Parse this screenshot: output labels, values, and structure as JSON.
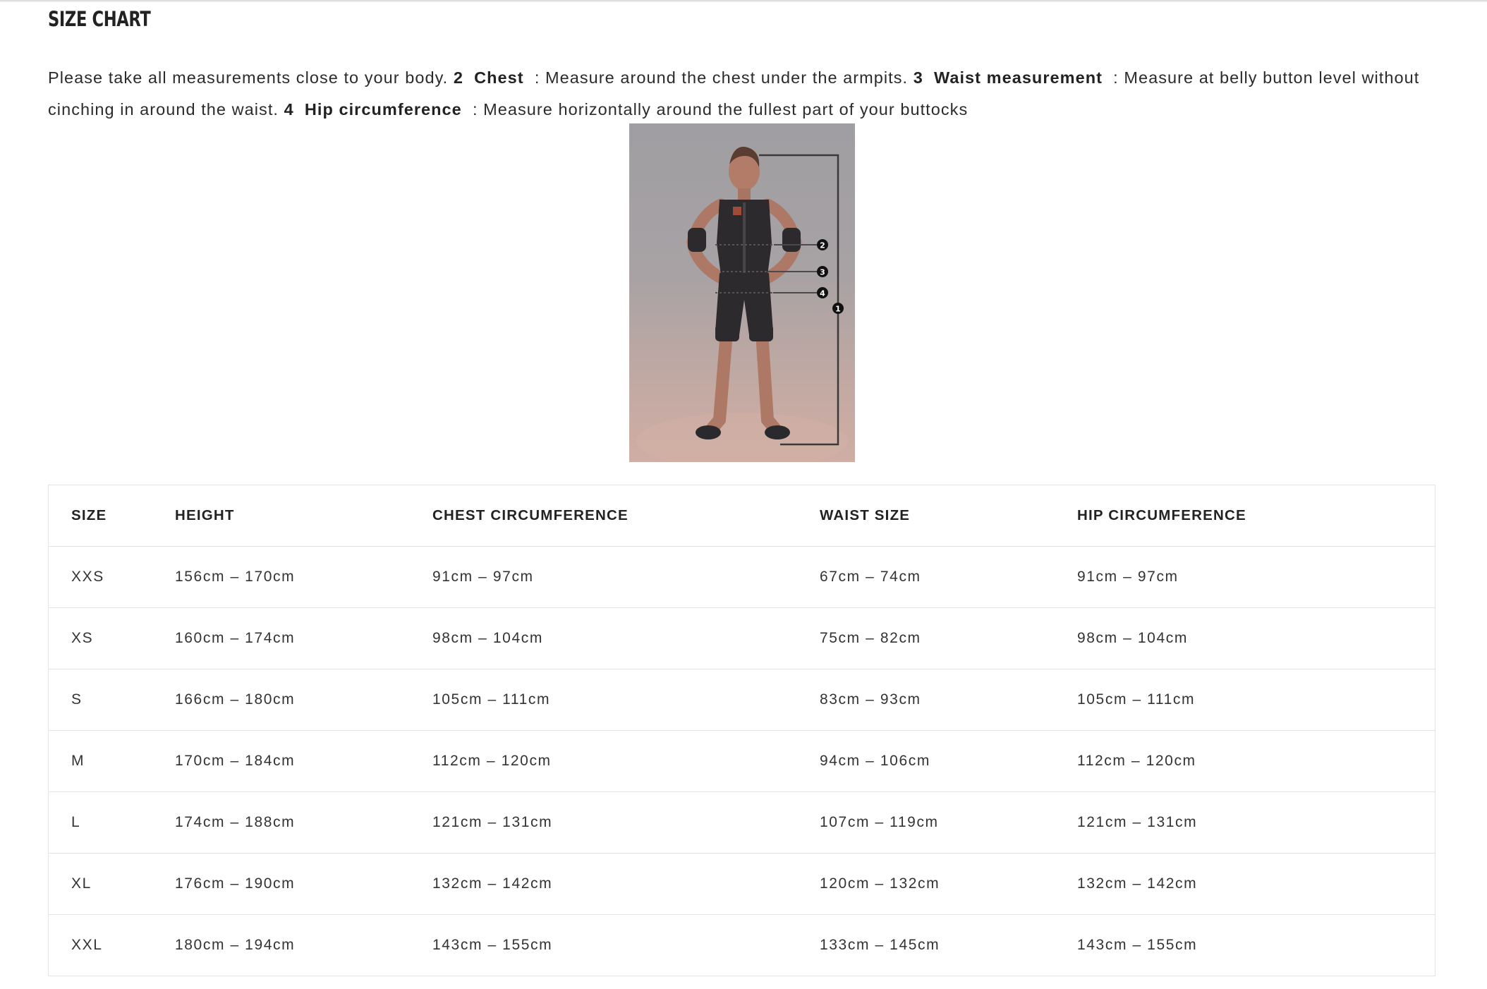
{
  "page": {
    "title": "SIZE CHART"
  },
  "instructions": {
    "lead": "Please take all measurements close to your body.",
    "items": [
      {
        "number": "2",
        "name": "Chest",
        "text": ": Measure around the chest under the armpits."
      },
      {
        "number": "3",
        "name": "Waist measurement",
        "text": ": Measure at belly button level without cinching in around the waist."
      },
      {
        "number": "4",
        "name": "Hip circumference",
        "text": ": Measure horizontally around the fullest part of your buttocks"
      }
    ]
  },
  "figure": {
    "markers": [
      "1",
      "2",
      "3",
      "4"
    ],
    "colors": {
      "background_top": "#9f9ea2",
      "background_bottom": "#cfaea4",
      "garment": "#2c2a2c",
      "skin": "#b07a68",
      "marker": "#111111"
    }
  },
  "table": {
    "headers": [
      "SIZE",
      "HEIGHT",
      "CHEST CIRCUMFERENCE",
      "WAIST SIZE",
      "HIP CIRCUMFERENCE"
    ],
    "rows": [
      [
        "XXS",
        "156cm – 170cm",
        "91cm – 97cm",
        "67cm – 74cm",
        "91cm – 97cm"
      ],
      [
        "XS",
        "160cm – 174cm",
        "98cm – 104cm",
        "75cm – 82cm",
        "98cm – 104cm"
      ],
      [
        "S",
        "166cm – 180cm",
        "105cm – 111cm",
        "83cm – 93cm",
        "105cm – 111cm"
      ],
      [
        "M",
        "170cm – 184cm",
        "112cm – 120cm",
        "94cm – 106cm",
        "112cm – 120cm"
      ],
      [
        "L",
        "174cm – 188cm",
        "121cm – 131cm",
        "107cm – 119cm",
        "121cm – 131cm"
      ],
      [
        "XL",
        "176cm – 190cm",
        "132cm – 142cm",
        "120cm – 132cm",
        "132cm – 142cm"
      ],
      [
        "XXL",
        "180cm – 194cm",
        "143cm – 155cm",
        "133cm – 145cm",
        "143cm – 155cm"
      ]
    ]
  },
  "colors": {
    "text": "#2b2b2b",
    "table_border": "#e3e3e3"
  }
}
